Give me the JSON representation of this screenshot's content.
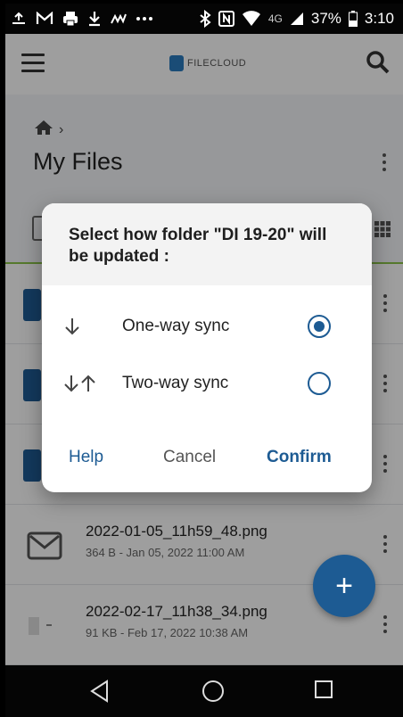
{
  "status_bar": {
    "icons": [
      "share-icon",
      "gmail-icon",
      "printer-icon",
      "download-icon",
      "wifi-direct-icon",
      "more-notifications-icon",
      "bluetooth-icon",
      "nfc-icon",
      "wifi-icon",
      "lte-signal-icon"
    ],
    "network": "4G",
    "battery": "37%",
    "time": "3:10"
  },
  "header": {
    "logo_text": "FILECLOUD"
  },
  "breadcrumb": {
    "separator": "›"
  },
  "page": {
    "title": "My Files"
  },
  "files": [
    {
      "name": "2022-01-05_11h59_48.png",
      "meta": "364 B - Jan 05, 2022 11:00 AM"
    },
    {
      "name": "2022-02-17_11h38_34.png",
      "meta": "91 KB - Feb 17, 2022 10:38 AM"
    }
  ],
  "fab": {
    "label": "+"
  },
  "dialog": {
    "title": "Select how folder \"DI 19-20\" will be updated :",
    "options": [
      {
        "label": "One-way sync",
        "checked": true
      },
      {
        "label": "Two-way sync",
        "checked": false
      }
    ],
    "help_label": "Help",
    "cancel_label": "Cancel",
    "confirm_label": "Confirm"
  },
  "colors": {
    "accent": "#1d5b93",
    "progress_line": "#8bc34a"
  }
}
